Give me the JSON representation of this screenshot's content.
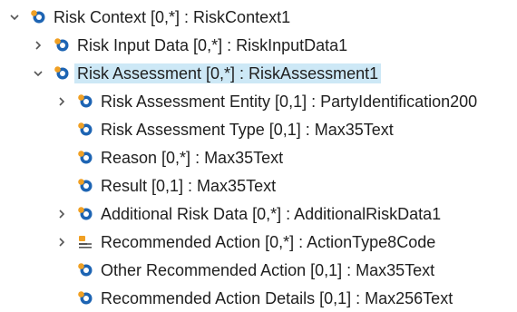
{
  "tree": {
    "root": {
      "label": "Risk Context [0,*] : RiskContext1",
      "icon": "element-component-icon",
      "expanded": true
    },
    "level1": [
      {
        "label": "Risk Input Data [0,*] : RiskInputData1",
        "icon": "element-component-icon",
        "expanded": false,
        "has_children": true,
        "selected": false
      },
      {
        "label": "Risk Assessment [0,*] : RiskAssessment1",
        "icon": "element-component-icon",
        "expanded": true,
        "has_children": true,
        "selected": true
      }
    ],
    "level2": [
      {
        "label": "Risk Assessment Entity [0,1] : PartyIdentification200",
        "icon": "element-component-icon",
        "has_children": true
      },
      {
        "label": "Risk Assessment Type [0,1] : Max35Text",
        "icon": "element-component-icon",
        "has_children": false
      },
      {
        "label": "Reason [0,*] : Max35Text",
        "icon": "element-component-icon",
        "has_children": false
      },
      {
        "label": "Result [0,1] : Max35Text",
        "icon": "element-component-icon",
        "has_children": false
      },
      {
        "label": "Additional Risk Data [0,*] : AdditionalRiskData1",
        "icon": "element-component-icon",
        "has_children": true
      },
      {
        "label": "Recommended Action [0,*] : ActionType8Code",
        "icon": "element-code-icon",
        "has_children": true
      },
      {
        "label": "Other Recommended Action [0,1] : Max35Text",
        "icon": "element-component-icon",
        "has_children": false
      },
      {
        "label": "Recommended Action Details [0,1] : Max256Text",
        "icon": "element-component-icon",
        "has_children": false
      }
    ],
    "colors": {
      "selection": "#cde8f6",
      "icon_blue": "#1d64b3",
      "icon_orange": "#f0a024",
      "twisty": "#555555",
      "text": "#1f1f1f"
    }
  }
}
